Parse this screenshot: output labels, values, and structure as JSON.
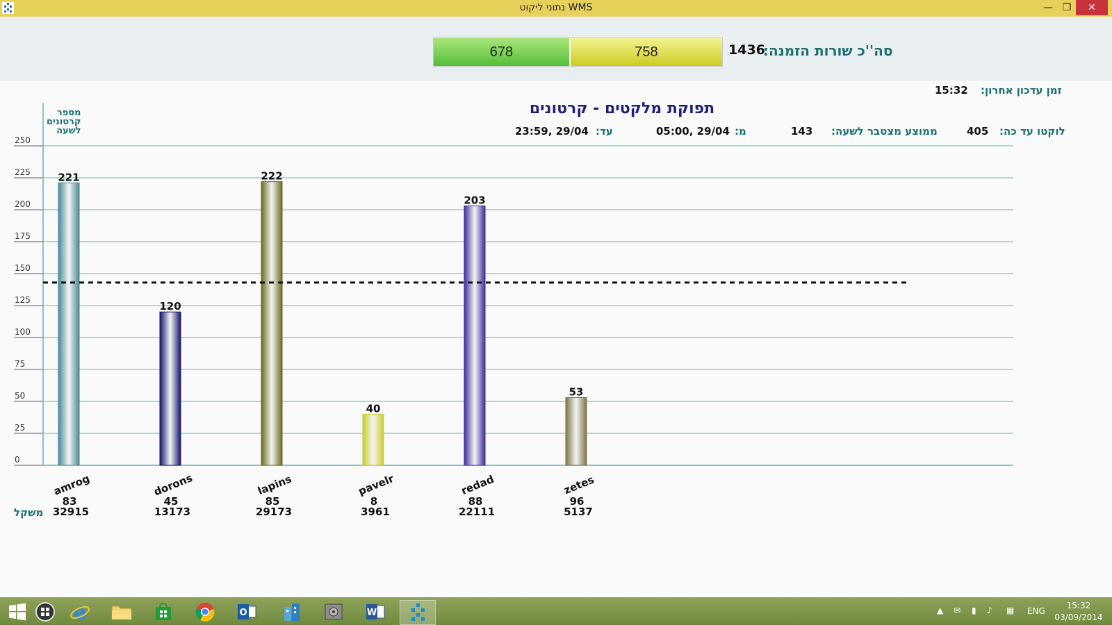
{
  "window": {
    "title": "נתוני ליקוט WMS",
    "min_glyph": "—",
    "max_glyph": "❐",
    "close_glyph": "✕"
  },
  "summary": {
    "total_label": "סה''כ שורות הזמנה:",
    "total_value": "1436",
    "green_value": "678",
    "yellow_value": "758",
    "green_fraction": 0.472,
    "colors": {
      "green": "#54be3a",
      "yellow": "#cccc22"
    }
  },
  "info": {
    "last_update_label": "זמן עדכון אחרון:",
    "last_update_value": "15:32",
    "picked_label": "לוקטו עד כה:",
    "picked_value": "405",
    "avg_label": "ממוצע מצטבר לשעה:",
    "avg_value": "143",
    "from_label": "מ:",
    "from_value": "29/04 ,05:00",
    "to_label": "עד:",
    "to_value": "29/04 ,23:59"
  },
  "chart_data": {
    "type": "bar",
    "title": "תפוקת מלקטים - קרטונים",
    "ylabel_lines": [
      "מספר",
      "קרטונים",
      "לשעה"
    ],
    "ylim": [
      0,
      250
    ],
    "yticks": [
      0,
      25,
      50,
      75,
      100,
      125,
      150,
      175,
      200,
      225,
      250
    ],
    "grid": true,
    "average_line": 143,
    "categories": [
      "amrog",
      "dorons",
      "lapins",
      "pavelr",
      "redad",
      "zetes"
    ],
    "values": [
      221,
      120,
      222,
      40,
      203,
      53
    ],
    "row2": [
      83,
      45,
      85,
      8,
      88,
      96
    ],
    "row3": [
      32915,
      13173,
      29173,
      3961,
      22111,
      5137
    ],
    "row3_label": "משקל",
    "colors": [
      "#4a8a96",
      "#14146a",
      "#6b6b1e",
      "#c8cc2a",
      "#3b2e9a",
      "#7a7448"
    ]
  },
  "taskbar": {
    "language": "ENG",
    "time": "15:32",
    "date": "03/09/2014"
  }
}
